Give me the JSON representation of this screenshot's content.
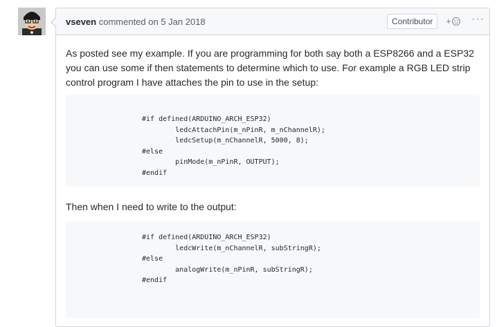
{
  "comment": {
    "author": "vseven",
    "action_text": "commented on 5 Jan 2018",
    "badge": "Contributor",
    "reaction_icon": "smiley-plus-icon",
    "more_icon": "kebab-horizontal-icon",
    "more_glyph": "···",
    "paragraph_1": "As posted see my example. If you are programming for both say both a ESP8266 and a ESP32 you can use some if then statements to determine which to use. For example a RGB LED strip control program I have attaches the pin to use in the setup:",
    "code_1": "#if defined(ARDUINO_ARCH_ESP32)\n        ledcAttachPin(m_nPinR, m_nChannelR);\n        ledcSetup(m_nChannelR, 5000, 8);\n#else\n        pinMode(m_nPinR, OUTPUT);\n#endif",
    "paragraph_2": "Then when I need to write to the output:",
    "code_2": "#if defined(ARDUINO_ARCH_ESP32)\n        ledcWrite(m_nChannelR, subStringR);\n#else\n        analogWrite(m_nPinR, subStringR);\n#endif"
  },
  "colors": {
    "border": "#d1d5da",
    "header_bg": "#f6f8fa",
    "code_bg": "#f6f8fa",
    "text": "#24292e",
    "muted": "#586069"
  }
}
